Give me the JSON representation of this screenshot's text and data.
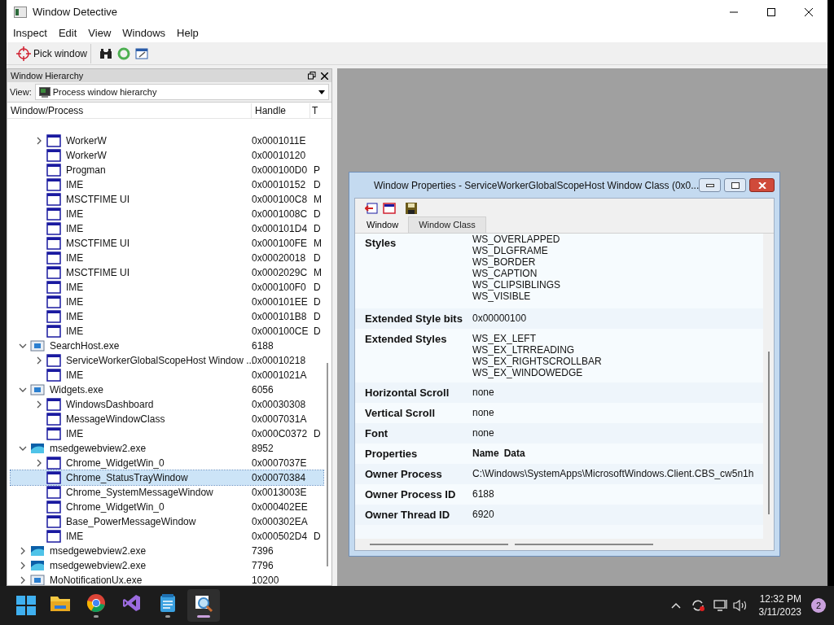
{
  "window": {
    "title": "Window Detective"
  },
  "menu": [
    "Inspect",
    "Edit",
    "View",
    "Windows",
    "Help"
  ],
  "toolbar": {
    "pick_label": "Pick window"
  },
  "hierarchy": {
    "title": "Window Hierarchy",
    "view_label": "View:",
    "view_value": "Process window hierarchy",
    "columns": [
      "Window/Process",
      "Handle",
      "T"
    ],
    "nodes": [
      {
        "kind": "window",
        "label": "WorkerW",
        "handle": "0x0001011E",
        "expanded": false,
        "selected": false
      },
      {
        "kind": "window",
        "label": "WorkerW",
        "handle": "0x00010120",
        "selected": false
      },
      {
        "kind": "window",
        "label": "Progman",
        "handle": "0x000100D0",
        "column_3": "P",
        "selected": false
      },
      {
        "kind": "window",
        "label": "IME",
        "handle": "0x00010152",
        "column_3": "D",
        "selected": false
      },
      {
        "kind": "window",
        "label": "MSCTFIME UI",
        "handle": "0x000100C8",
        "column_3": "M",
        "selected": false
      },
      {
        "kind": "window",
        "label": "IME",
        "handle": "0x0001008C",
        "column_3": "D",
        "selected": false
      },
      {
        "kind": "window",
        "label": "IME",
        "handle": "0x000101D4",
        "column_3": "D",
        "selected": false
      },
      {
        "kind": "window",
        "label": "MSCTFIME UI",
        "handle": "0x000100FE",
        "column_3": "M",
        "selected": false
      },
      {
        "kind": "window",
        "label": "IME",
        "handle": "0x00020018",
        "column_3": "D",
        "selected": false
      },
      {
        "kind": "window",
        "label": "MSCTFIME UI",
        "handle": "0x0002029C",
        "column_3": "M",
        "selected": false
      },
      {
        "kind": "window",
        "label": "IME",
        "handle": "0x000100F0",
        "column_3": "D",
        "selected": false
      },
      {
        "kind": "window",
        "label": "IME",
        "handle": "0x000101EE",
        "column_3": "D",
        "selected": false
      },
      {
        "kind": "window",
        "label": "IME",
        "handle": "0x000101B8",
        "column_3": "D",
        "selected": false
      },
      {
        "kind": "window",
        "label": "IME",
        "handle": "0x000100CE",
        "column_3": "D",
        "selected": false
      },
      {
        "kind": "process",
        "label": "SearchHost.exe",
        "handle": "6188",
        "expanded": true,
        "selected": false,
        "children": [
          {
            "kind": "window",
            "label": "ServiceWorkerGlobalScopeHost Window ...",
            "handle": "0x00010218",
            "expanded": false,
            "selected": false
          },
          {
            "kind": "window",
            "label": "IME",
            "handle": "0x0001021A",
            "selected": false
          }
        ]
      },
      {
        "kind": "process",
        "label": "Widgets.exe",
        "handle": "6056",
        "expanded": true,
        "selected": false,
        "children": [
          {
            "kind": "window",
            "label": "WindowsDashboard",
            "handle": "0x00030308",
            "expanded": false,
            "selected": false
          },
          {
            "kind": "window",
            "label": "MessageWindowClass",
            "handle": "0x0007031A",
            "selected": false
          },
          {
            "kind": "window",
            "label": "IME",
            "handle": "0x000C0372",
            "column_3": "D",
            "selected": false
          }
        ]
      },
      {
        "kind": "webview",
        "label": "msedgewebview2.exe",
        "handle": "8952",
        "expanded": true,
        "selected": false,
        "children": [
          {
            "kind": "window",
            "label": "Chrome_WidgetWin_0",
            "handle": "0x0007037E",
            "expanded": false,
            "selected": false
          },
          {
            "kind": "window",
            "label": "Chrome_StatusTrayWindow",
            "handle": "0x00070384",
            "selected": true
          },
          {
            "kind": "window",
            "label": "Chrome_SystemMessageWindow",
            "handle": "0x0013003E",
            "selected": false
          },
          {
            "kind": "window",
            "label": "Chrome_WidgetWin_0",
            "handle": "0x000402EE",
            "selected": false
          },
          {
            "kind": "window",
            "label": "Base_PowerMessageWindow",
            "handle": "0x000302EA",
            "selected": false
          },
          {
            "kind": "window",
            "label": "IME",
            "handle": "0x000502D4",
            "column_3": "D",
            "selected": false
          }
        ]
      },
      {
        "kind": "webview",
        "label": "msedgewebview2.exe",
        "handle": "7396",
        "expanded": false,
        "selected": false
      },
      {
        "kind": "webview",
        "label": "msedgewebview2.exe",
        "handle": "7796",
        "expanded": false,
        "selected": false
      },
      {
        "kind": "process",
        "label": "MoNotificationUx.exe",
        "handle": "10200",
        "expanded": false,
        "selected": false
      }
    ]
  },
  "properties": {
    "title": "Window Properties - ServiceWorkerGlobalScopeHost Window Class (0x0...",
    "tabs": [
      {
        "label": "Window",
        "selected": true
      },
      {
        "label": "Window Class",
        "selected": false
      }
    ],
    "rows": [
      {
        "label": "Styles",
        "values": [
          "WS_OVERLAPPED",
          "WS_DLGFRAME",
          "WS_BORDER",
          "WS_CAPTION",
          "WS_CLIPSIBLINGS",
          "WS_VISIBLE"
        ]
      },
      {
        "label": "Extended Style bits",
        "values": [
          "0x00000100"
        ]
      },
      {
        "label": "Extended Styles",
        "values": [
          "WS_EX_LEFT",
          "WS_EX_LTRREADING",
          "WS_EX_RIGHTSCROLLBAR",
          "WS_EX_WINDOWEDGE"
        ]
      },
      {
        "label": "Horizontal Scroll",
        "values": [
          "none"
        ]
      },
      {
        "label": "Vertical Scroll",
        "values": [
          "none"
        ]
      },
      {
        "label": "Font",
        "values": [
          "none"
        ]
      },
      {
        "label": "Properties",
        "kind": "columns",
        "values": [
          "Name",
          "Data"
        ]
      },
      {
        "label": "Owner Process",
        "values": [
          "C:\\Windows\\SystemApps\\MicrosoftWindows.Client.CBS_cw5n1h"
        ]
      },
      {
        "label": "Owner Process ID",
        "values": [
          "6188"
        ]
      },
      {
        "label": "Owner Thread ID",
        "values": [
          "6920"
        ]
      }
    ]
  },
  "taskbar": {
    "apps": [
      {
        "kind": "files",
        "running": false,
        "selected": false
      },
      {
        "kind": "chrome",
        "running": true,
        "selected": false
      },
      {
        "kind": "vs",
        "running": false,
        "selected": false
      },
      {
        "kind": "notepad",
        "running": true,
        "selected": false
      },
      {
        "kind": "detective",
        "running": true,
        "selected": true
      }
    ],
    "time": "12:32 PM",
    "date": "3/11/2023",
    "badge": "2"
  }
}
